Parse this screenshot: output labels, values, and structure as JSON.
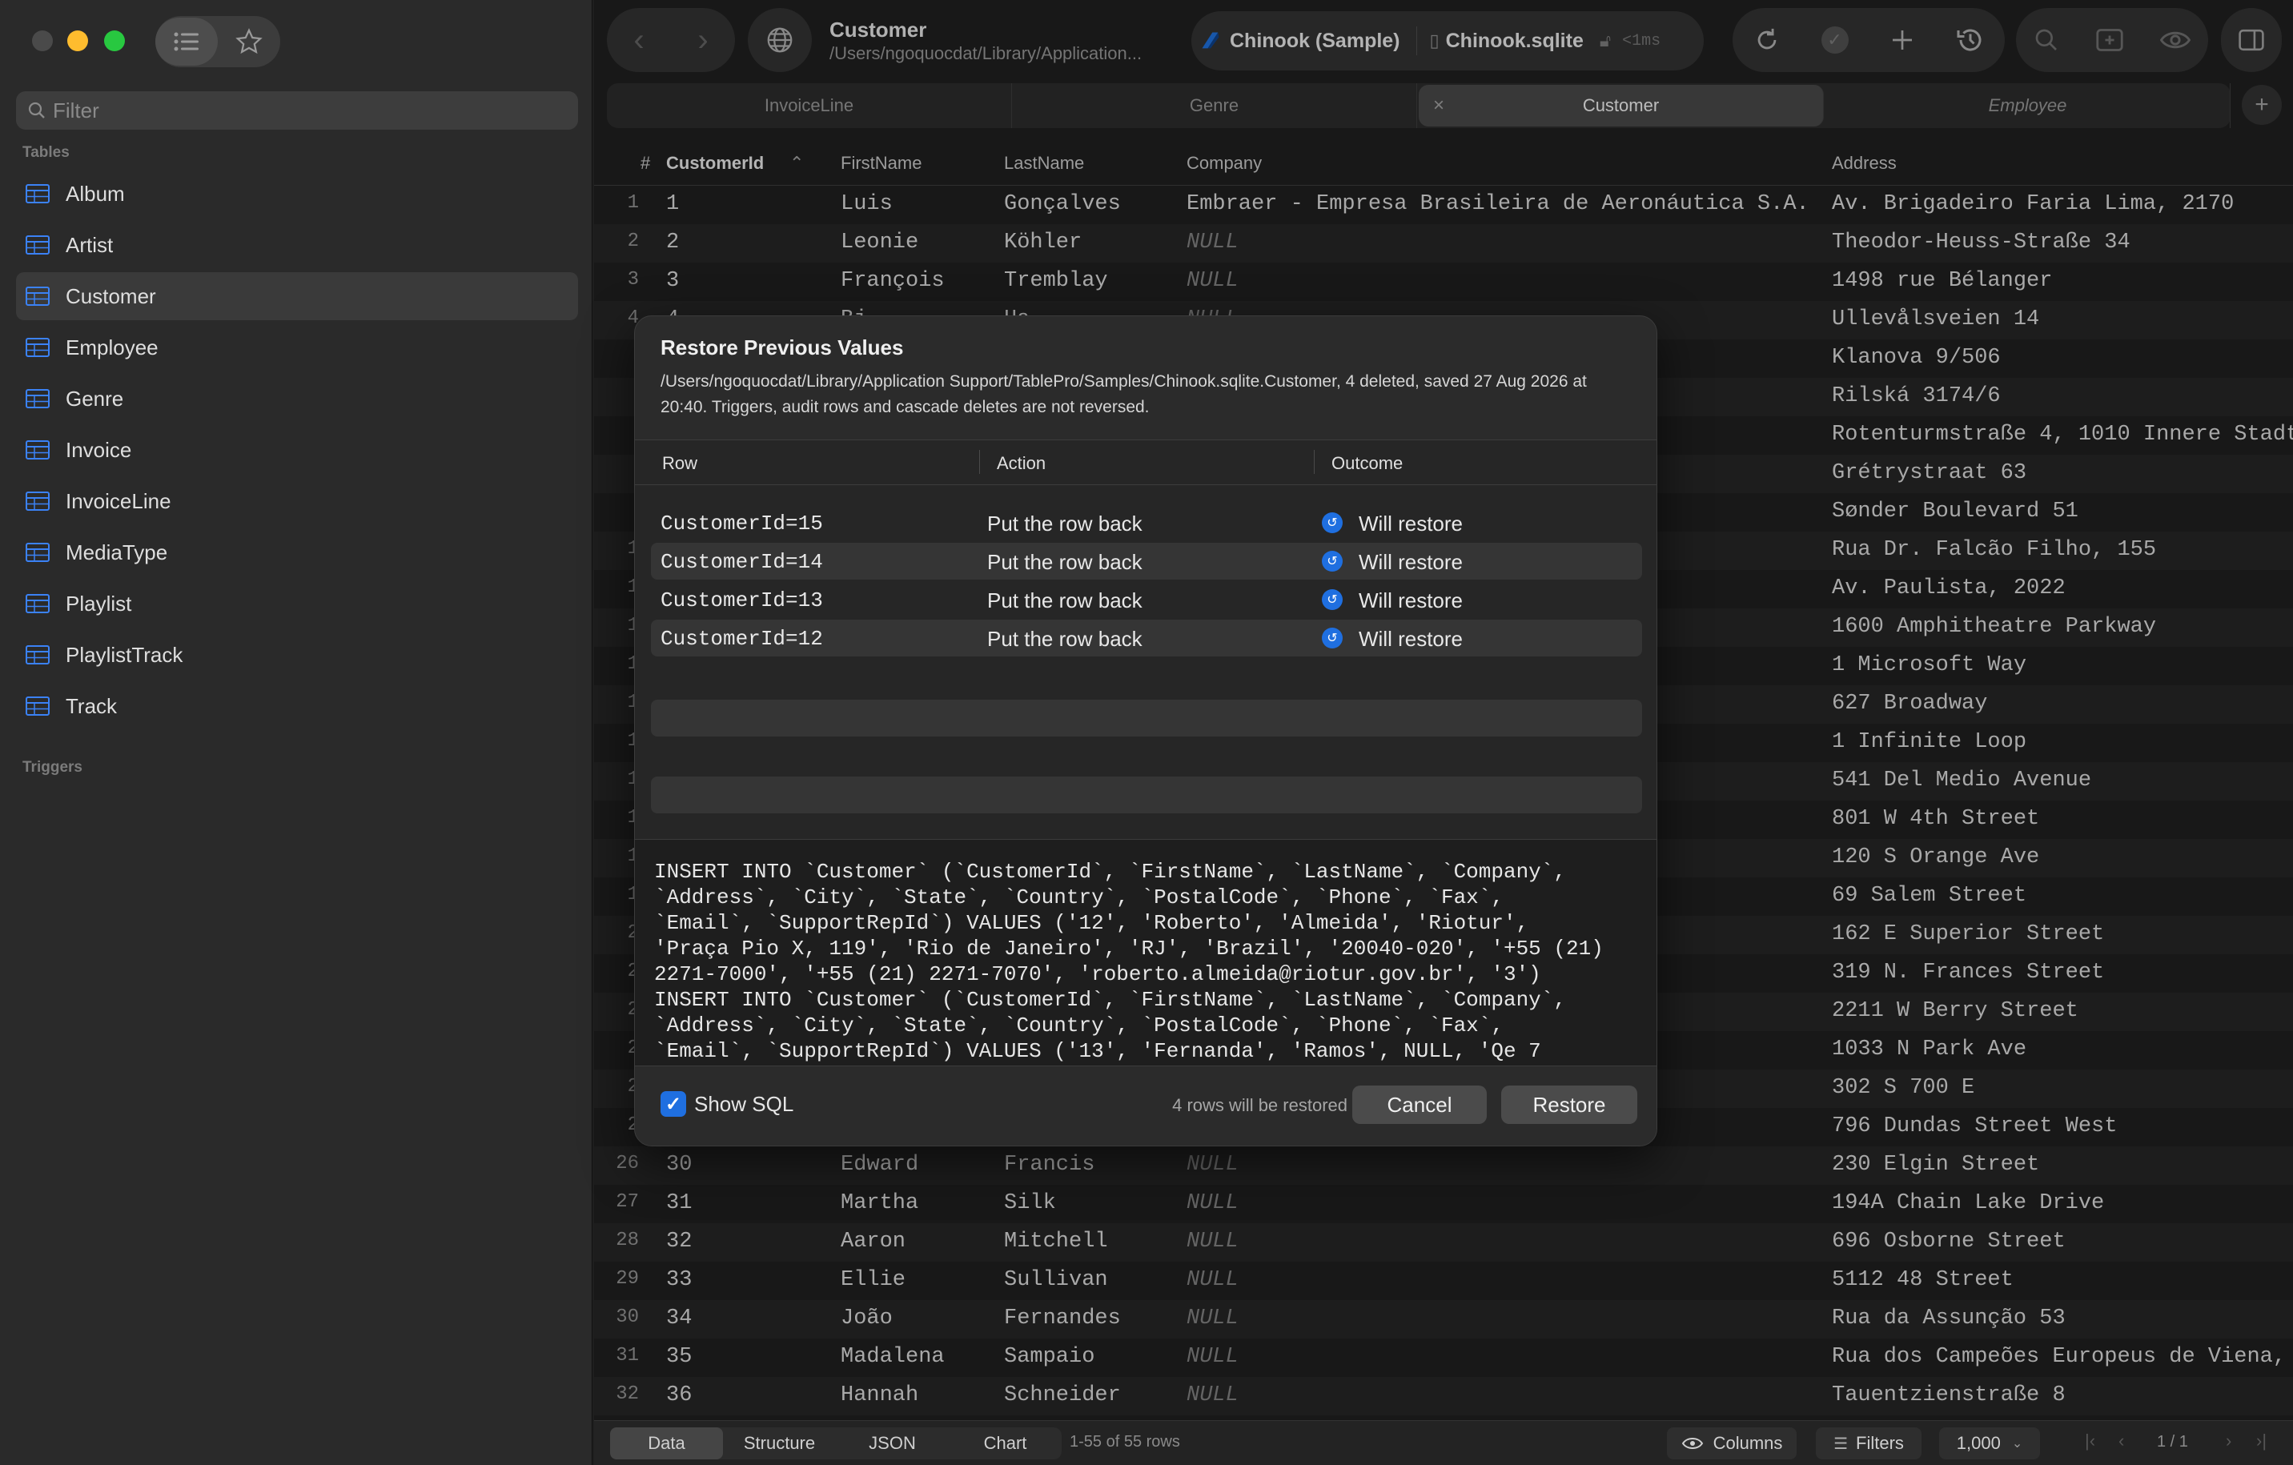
{
  "window": {
    "traffic_lights": [
      "#444444",
      "#febc2e",
      "#28c840"
    ]
  },
  "sidebar": {
    "filter_placeholder": "Filter",
    "tables_heading": "Tables",
    "triggers_heading": "Triggers",
    "items": [
      {
        "label": "Album"
      },
      {
        "label": "Artist"
      },
      {
        "label": "Customer",
        "selected": true
      },
      {
        "label": "Employee"
      },
      {
        "label": "Genre"
      },
      {
        "label": "Invoice"
      },
      {
        "label": "InvoiceLine"
      },
      {
        "label": "MediaType"
      },
      {
        "label": "Playlist"
      },
      {
        "label": "PlaylistTrack"
      },
      {
        "label": "Track"
      }
    ]
  },
  "toolbar": {
    "title": "Customer",
    "path": "/Users/ngoquocdat/Library/Application...",
    "connection": "Chinook (Sample)",
    "database": "Chinook.sqlite",
    "latency": "<1ms"
  },
  "tabs": [
    {
      "label": "InvoiceLine"
    },
    {
      "label": "Genre"
    },
    {
      "label": "Customer",
      "active": true
    },
    {
      "label": "Employee",
      "italic": true
    }
  ],
  "grid": {
    "columns": [
      "#",
      "CustomerId",
      "FirstName",
      "LastName",
      "Company",
      "Address"
    ],
    "rows": [
      [
        "1",
        "1",
        "Luis",
        "Gonçalves",
        "Embraer - Empresa Brasileira de Aeronáutica S.A.",
        "Av. Brigadeiro Faria Lima, 2170"
      ],
      [
        "2",
        "2",
        "Leonie",
        "Köhler",
        "NULL",
        "Theodor-Heuss-Straße 34"
      ],
      [
        "3",
        "3",
        "François",
        "Tremblay",
        "NULL",
        "1498 rue Bélanger"
      ],
      [
        "4",
        "4",
        "Bj",
        "Ha",
        "NULL",
        "Ullevålsveien 14"
      ],
      [
        "",
        "",
        "",
        "",
        "",
        "Klanova 9/506"
      ],
      [
        "",
        "",
        "",
        "",
        "",
        "Rilská 3174/6"
      ],
      [
        "",
        "",
        "",
        "",
        "",
        "Rotenturmstraße 4, 1010 Innere Stadt"
      ],
      [
        "",
        "",
        "",
        "",
        "",
        "Grétrystraat 63"
      ],
      [
        "",
        "",
        "",
        "",
        "",
        "Sønder Boulevard 51"
      ],
      [
        "1",
        "",
        "",
        "",
        "",
        "Rua Dr. Falcão Filho, 155"
      ],
      [
        "1",
        "",
        "",
        "",
        "",
        "Av. Paulista, 2022"
      ],
      [
        "1",
        "",
        "",
        "",
        "",
        "1600 Amphitheatre Parkway"
      ],
      [
        "1",
        "",
        "",
        "",
        "",
        "1 Microsoft Way"
      ],
      [
        "1",
        "",
        "",
        "",
        "",
        "627 Broadway"
      ],
      [
        "1",
        "",
        "",
        "",
        "",
        "1 Infinite Loop"
      ],
      [
        "1",
        "",
        "",
        "",
        "",
        "541 Del Medio Avenue"
      ],
      [
        "1",
        "",
        "",
        "",
        "",
        "801 W 4th Street"
      ],
      [
        "1",
        "",
        "",
        "",
        "",
        "120 S Orange Ave"
      ],
      [
        "1",
        "",
        "",
        "",
        "",
        "69 Salem Street"
      ],
      [
        "2",
        "",
        "",
        "",
        "",
        "162 E Superior Street"
      ],
      [
        "2",
        "",
        "",
        "",
        "",
        "319 N. Frances Street"
      ],
      [
        "2",
        "",
        "",
        "",
        "",
        "2211 W Berry Street"
      ],
      [
        "2",
        "",
        "",
        "",
        "",
        "1033 N Park Ave"
      ],
      [
        "2",
        "",
        "",
        "",
        "",
        "302 S 700 E"
      ],
      [
        "2",
        "",
        "",
        "",
        "",
        "796 Dundas Street West"
      ],
      [
        "26",
        "30",
        "Edward",
        "Francis",
        "NULL",
        "230 Elgin Street"
      ],
      [
        "27",
        "31",
        "Martha",
        "Silk",
        "NULL",
        "194A Chain Lake Drive"
      ],
      [
        "28",
        "32",
        "Aaron",
        "Mitchell",
        "NULL",
        "696 Osborne Street"
      ],
      [
        "29",
        "33",
        "Ellie",
        "Sullivan",
        "NULL",
        "5112 48 Street"
      ],
      [
        "30",
        "34",
        "João",
        "Fernandes",
        "NULL",
        "Rua da Assunção 53"
      ],
      [
        "31",
        "35",
        "Madalena",
        "Sampaio",
        "NULL",
        "Rua dos Campeões Europeus de Viena,"
      ],
      [
        "32",
        "36",
        "Hannah",
        "Schneider",
        "NULL",
        "Tauentzienstraße 8"
      ]
    ]
  },
  "dialog": {
    "title": "Restore Previous Values",
    "subtitle": "/Users/ngoquocdat/Library/Application Support/TablePro/Samples/Chinook.sqlite.Customer, 4 deleted, saved 27 Aug 2026 at 20:40. Triggers, audit rows and cascade deletes are not reversed.",
    "headers": {
      "row": "Row",
      "action": "Action",
      "outcome": "Outcome"
    },
    "rows": [
      {
        "row": "CustomerId=15",
        "action": "Put the row back",
        "outcome": "Will restore"
      },
      {
        "row": "CustomerId=14",
        "action": "Put the row back",
        "outcome": "Will restore"
      },
      {
        "row": "CustomerId=13",
        "action": "Put the row back",
        "outcome": "Will restore"
      },
      {
        "row": "CustomerId=12",
        "action": "Put the row back",
        "outcome": "Will restore"
      }
    ],
    "sql": "INSERT INTO `Customer` (`CustomerId`, `FirstName`, `LastName`, `Company`,\n`Address`, `City`, `State`, `Country`, `PostalCode`, `Phone`, `Fax`,\n`Email`, `SupportRepId`) VALUES ('12', 'Roberto', 'Almeida', 'Riotur',\n'Praça Pio X, 119', 'Rio de Janeiro', 'RJ', 'Brazil', '20040-020', '+55 (21)\n2271-7000', '+55 (21) 2271-7070', 'roberto.almeida@riotur.gov.br', '3')\nINSERT INTO `Customer` (`CustomerId`, `FirstName`, `LastName`, `Company`,\n`Address`, `City`, `State`, `Country`, `PostalCode`, `Phone`, `Fax`,\n`Email`, `SupportRepId`) VALUES ('13', 'Fernanda', 'Ramos', NULL, 'Qe 7",
    "show_sql_label": "Show SQL",
    "show_sql_checked": true,
    "summary": "4 rows will be restored",
    "cancel_label": "Cancel",
    "restore_label": "Restore"
  },
  "statusbar": {
    "tabs": [
      "Data",
      "Structure",
      "JSON",
      "Chart"
    ],
    "row_count": "1-55 of 55 rows",
    "columns_label": "Columns",
    "filters_label": "Filters",
    "page_size": "1,000",
    "page": "1 / 1"
  },
  "colors": {
    "accent": "#1f6fe0",
    "table_icon": "#3b82f6"
  }
}
